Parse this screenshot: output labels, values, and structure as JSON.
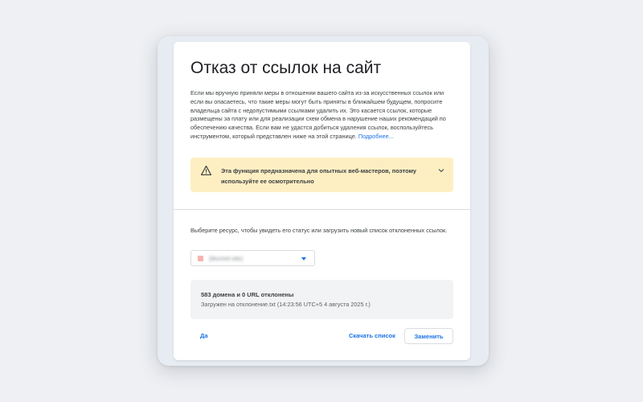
{
  "title": "Отказ от ссылок на сайт",
  "description": {
    "text": "Если мы вручную приняли меры в отношении вашего сайта из-за искусственных ссылок или если вы опасаетесь, что такие меры могут быть приняты в ближайшем будущем, попросите владельца сайта с недопустимыми ссылками удалить их. Это касается ссылок, которые размещены за плату или для реализации схем обмена в нарушение наших рекомендаций по обеспечению качества. Если вам не удастся добиться удаления ссылок, воспользуйтесь инструментом, который представлен ниже на этой странице.",
    "more_link": "Подробнее..."
  },
  "warning": {
    "icon": "warning-triangle-icon",
    "text": "Эта функция предназначена для опытных веб-мастеров, поэтому используйте ее осмотрительно",
    "expand_icon": "chevron-down-icon"
  },
  "resource": {
    "prompt": "Выберите ресурс, чтобы увидеть его статус или загрузить новый список отклоненных ссылок.",
    "selected": "(blurred site)",
    "caret_icon": "dropdown-caret-icon"
  },
  "status": {
    "summary": "583 домена и 0 URL отклонены",
    "uploaded": "Загружен на отклонение.txt (14:23:56 UTC+5 4 августа 2025 г.)"
  },
  "actions": {
    "yes": "Да",
    "download": "Скачать список",
    "replace": "Заменить"
  },
  "colors": {
    "background": "#eef0f4",
    "card": "#ffffff",
    "accent": "#1a73e8",
    "warning_bg": "#feefc3",
    "status_bg": "#f1f3f4",
    "text": "#202124"
  }
}
